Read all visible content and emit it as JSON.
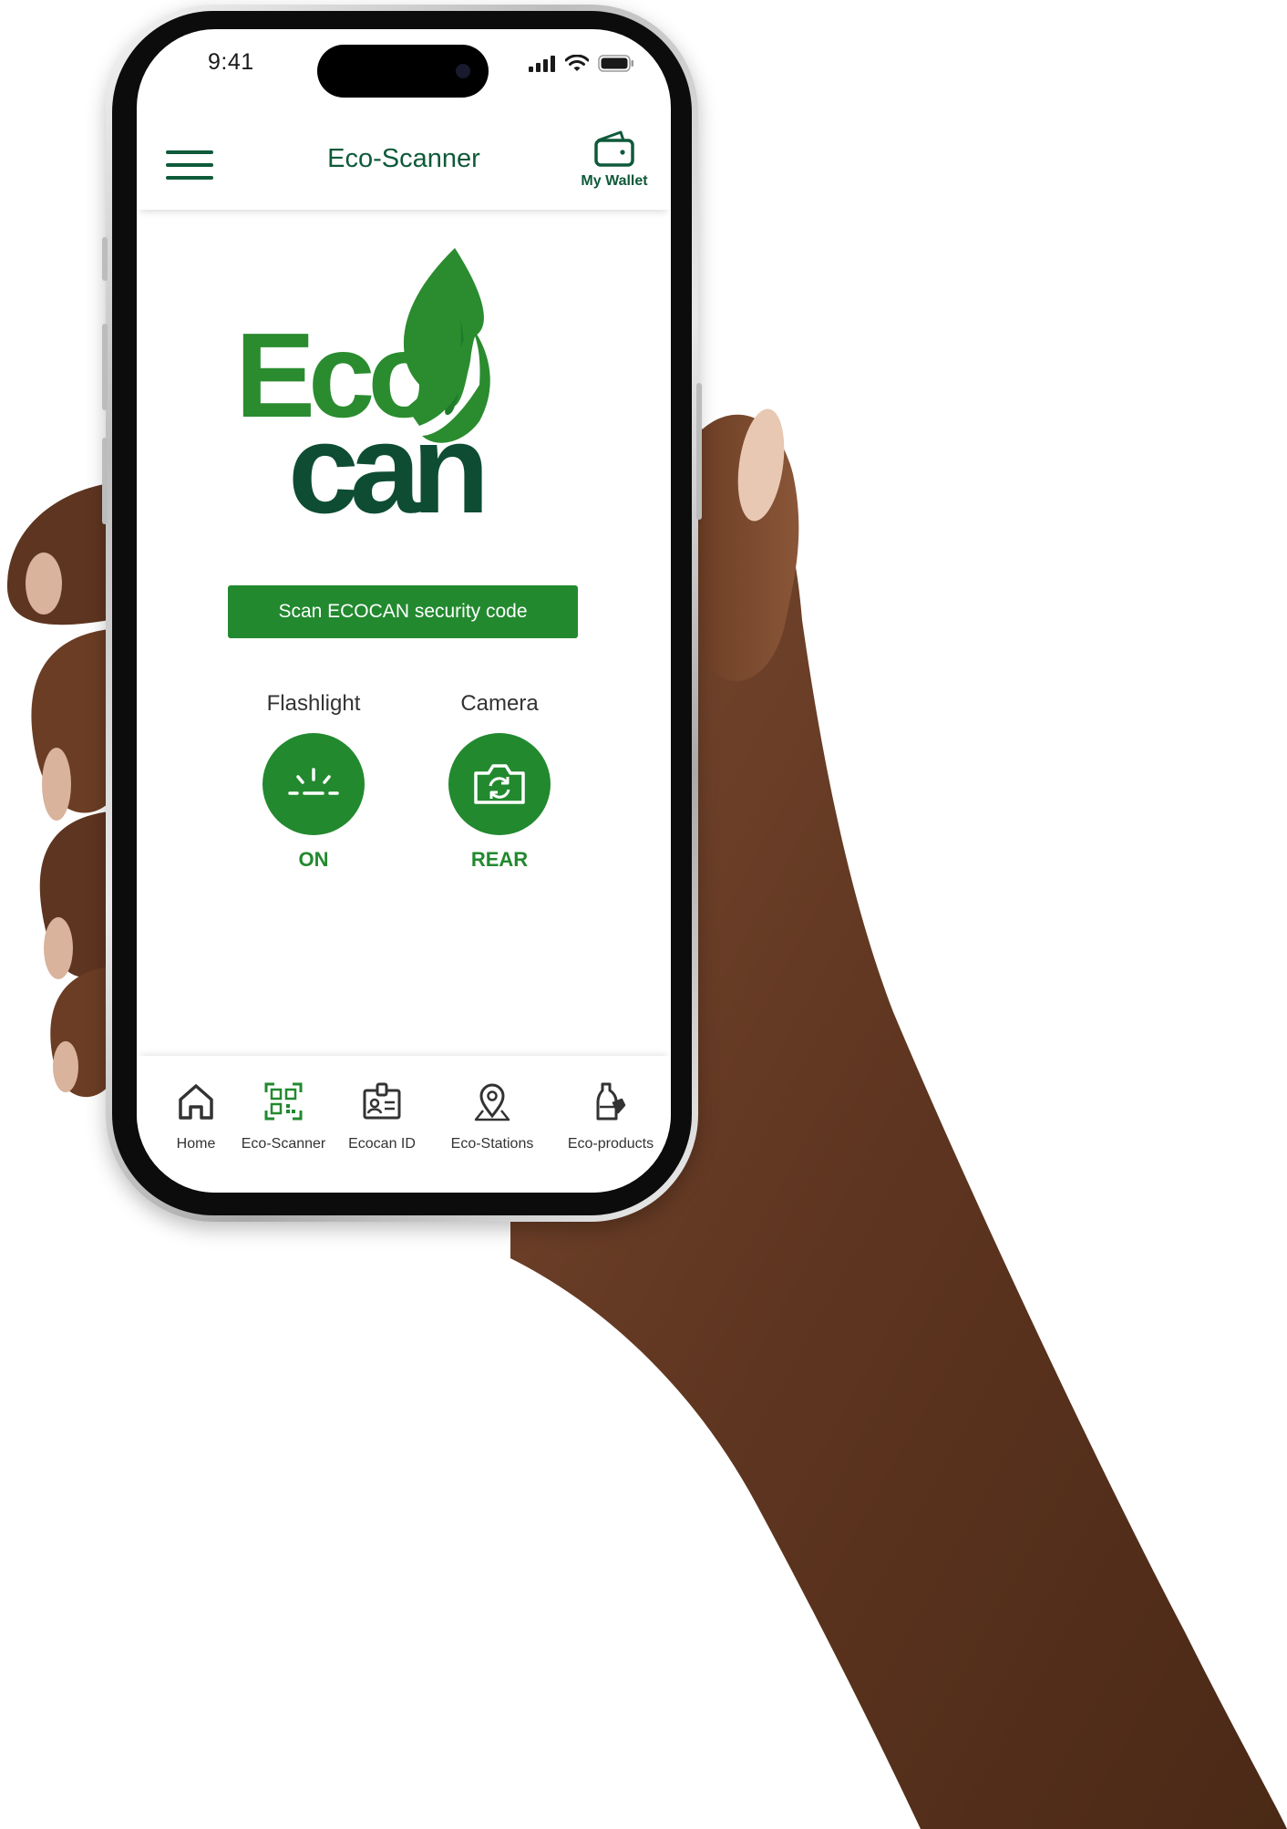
{
  "status_bar": {
    "time": "9:41"
  },
  "header": {
    "title": "Eco-Scanner",
    "wallet_label": "My Wallet"
  },
  "logo": {
    "line1": "Eco",
    "line2": "can",
    "color_light": "#2a8c2f",
    "color_dark": "#0e4d34"
  },
  "scan_button": {
    "label": "Scan ECOCAN security code"
  },
  "controls": {
    "flashlight": {
      "label": "Flashlight",
      "value": "ON"
    },
    "camera": {
      "label": "Camera",
      "value": "REAR"
    }
  },
  "bottom_nav": [
    {
      "label": "Home",
      "icon": "home-icon",
      "active": false
    },
    {
      "label": "Eco-Scanner",
      "icon": "qr-scanner-icon",
      "active": true
    },
    {
      "label": "Ecocan ID",
      "icon": "id-badge-icon",
      "active": false
    },
    {
      "label": "Eco-Stations",
      "icon": "map-pin-icon",
      "active": false
    },
    {
      "label": "Eco-products",
      "icon": "bottle-icon",
      "active": false
    }
  ],
  "colors": {
    "brand_green": "#22892f",
    "dark_green": "#0e5a3a",
    "text": "#333333"
  }
}
